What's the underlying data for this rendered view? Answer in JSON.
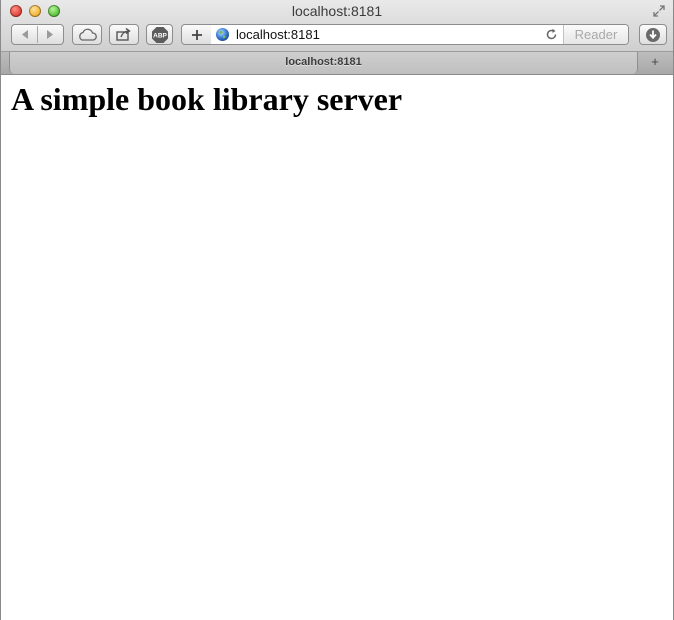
{
  "window": {
    "title": "localhost:8181"
  },
  "toolbar": {
    "address": "localhost:8181",
    "reader_label": "Reader",
    "adblock_label": "ABP",
    "add_label": "+"
  },
  "tabs": [
    {
      "label": "localhost:8181",
      "active": true
    }
  ],
  "new_tab_label": "+",
  "page": {
    "heading": "A simple book library server"
  },
  "icons": {
    "back": "back-arrow-icon",
    "forward": "forward-arrow-icon",
    "icloud": "cloud-icon",
    "share": "share-icon",
    "adblock": "adblock-icon",
    "add_bookmark": "plus-icon",
    "site": "globe-icon",
    "reload": "reload-icon",
    "downloads": "download-icon",
    "fullscreen": "fullscreen-icon"
  },
  "colors": {
    "close": "#e0443a",
    "minimize": "#f2b43b",
    "maximize": "#5bc33c"
  }
}
